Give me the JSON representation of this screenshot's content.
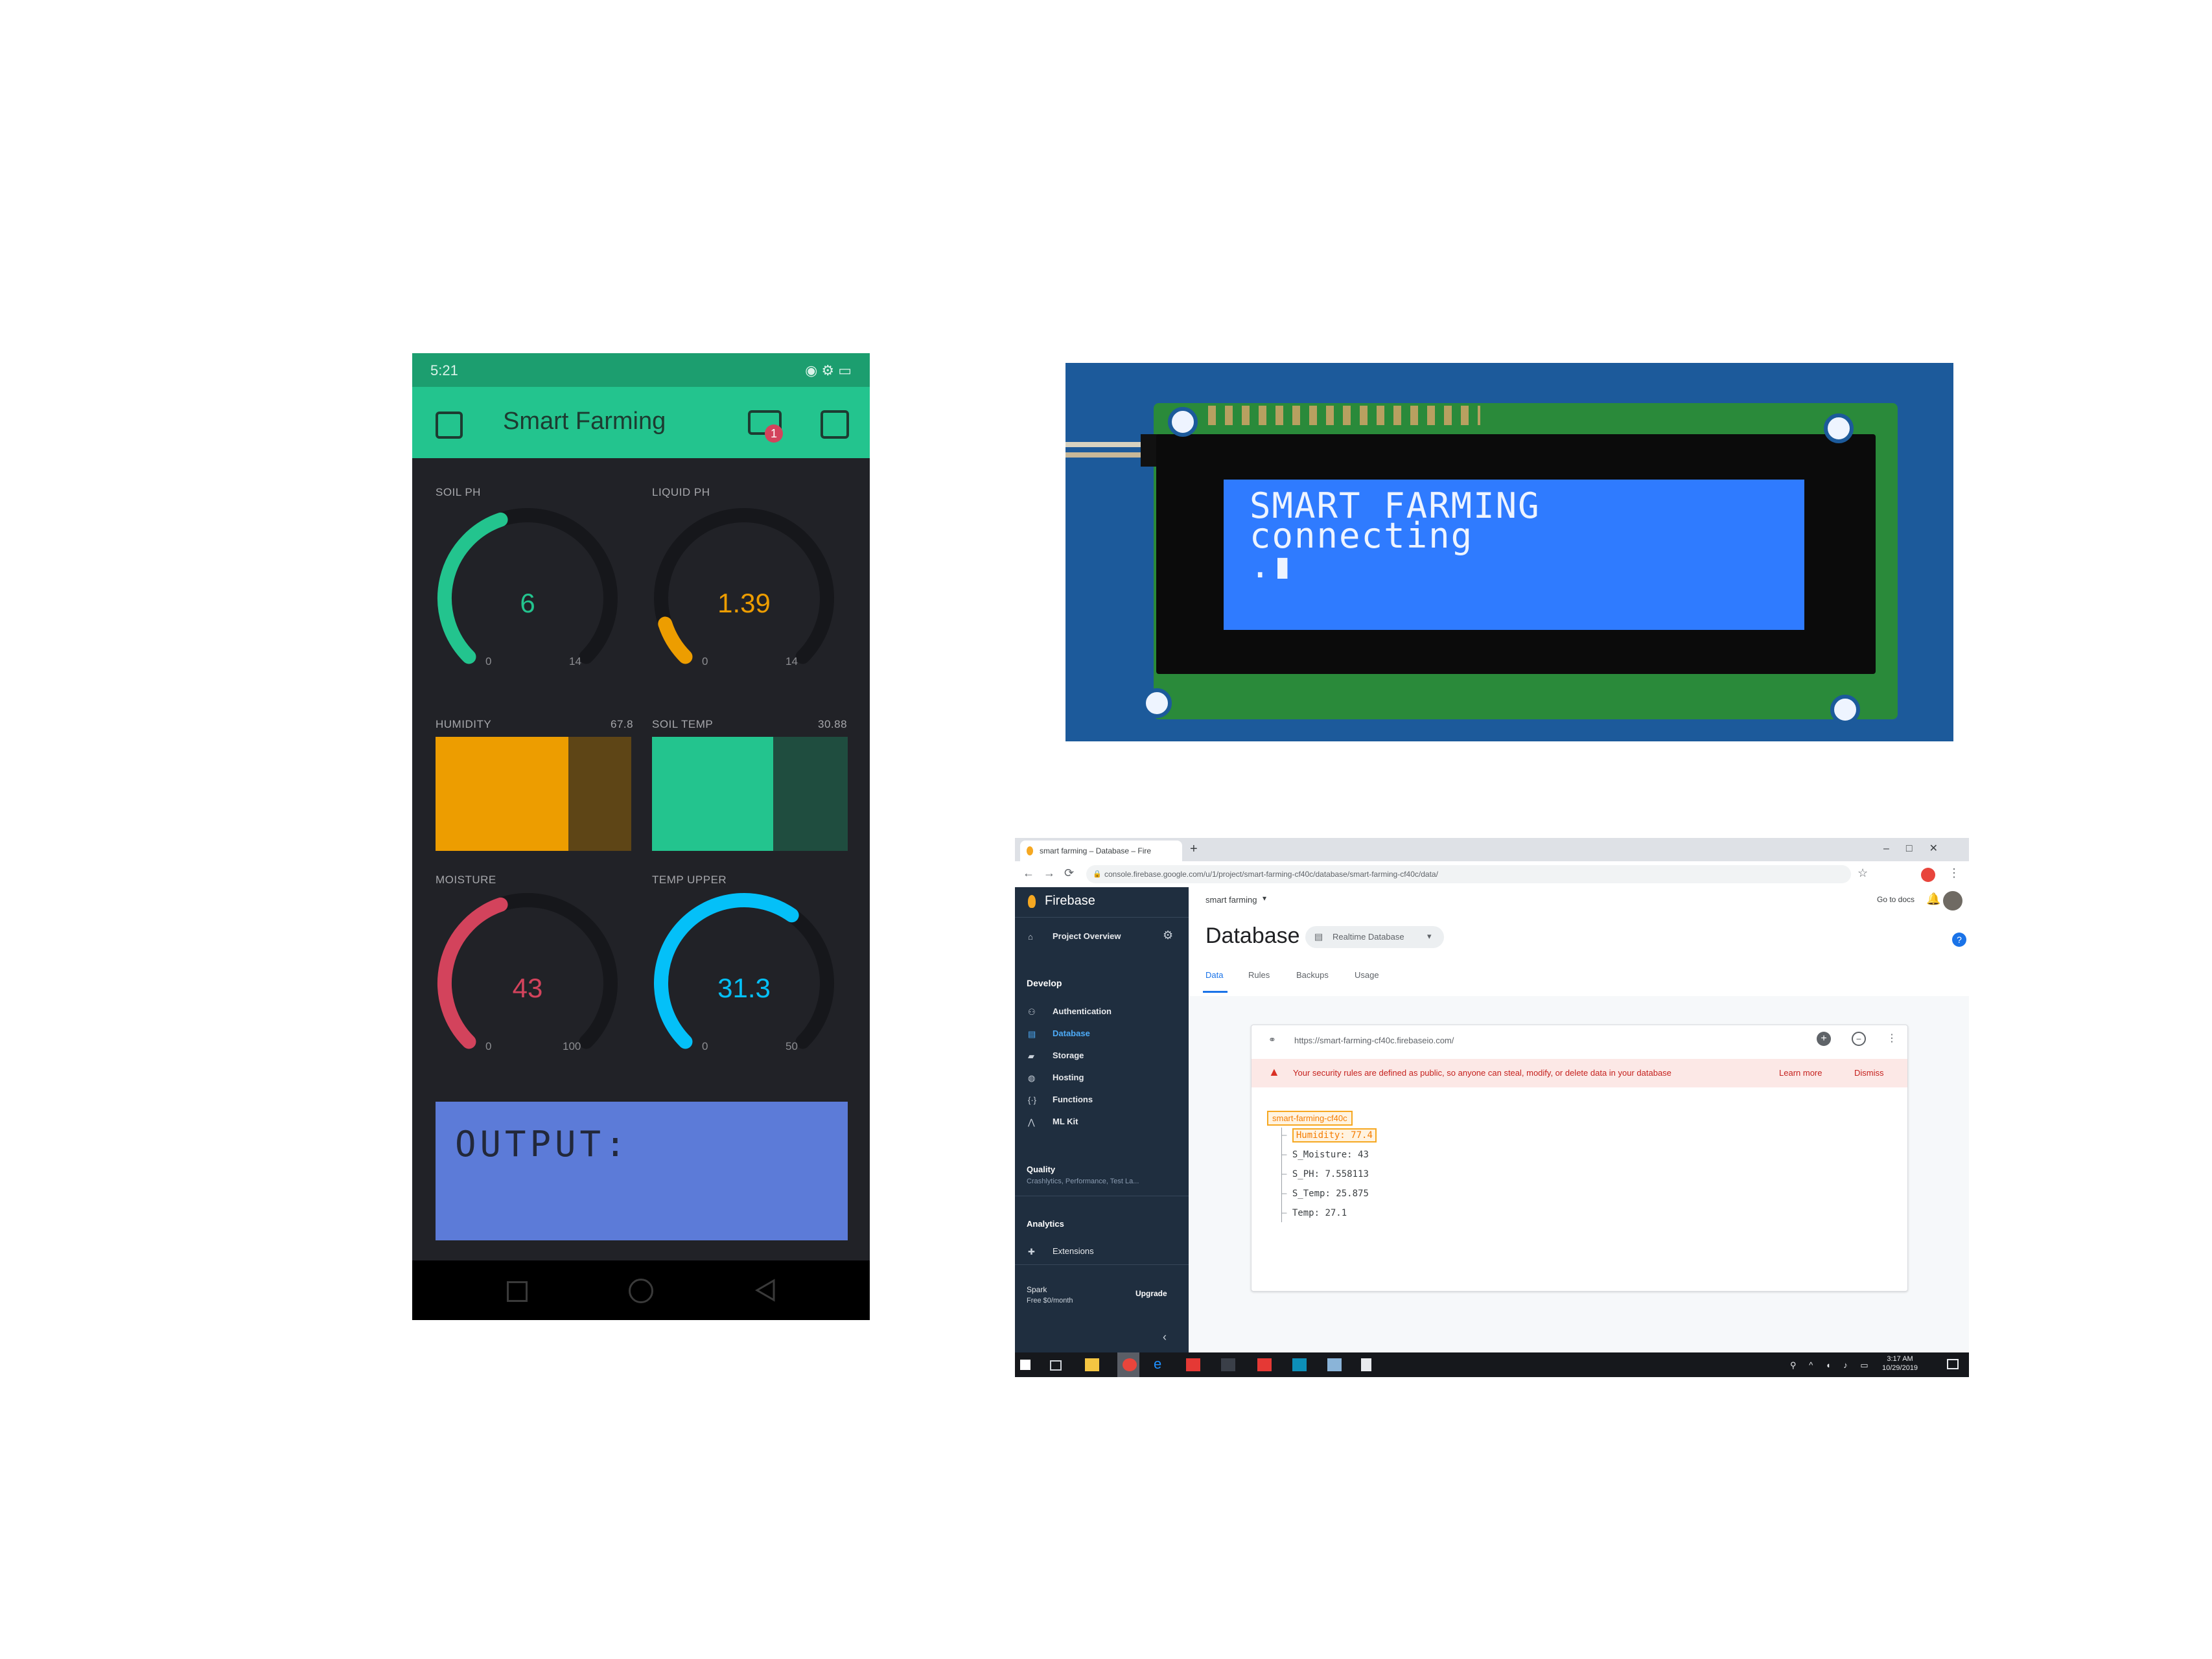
{
  "phone": {
    "status": {
      "time": "5:21",
      "icons": "◉ ⚙ ▭"
    },
    "app_title": "Smart Farming",
    "notification_count": "1",
    "gauges": [
      {
        "label": "SOIL PH",
        "value": "6",
        "min": "0",
        "max": "14",
        "color": "#23c48e",
        "fraction": 0.43
      },
      {
        "label": "LIQUID PH",
        "value": "1.39",
        "min": "0",
        "max": "14",
        "color": "#ed9d00",
        "fraction": 0.1
      },
      {
        "label": "MOISTURE",
        "value": "43",
        "min": "0",
        "max": "100",
        "color": "#d3435c",
        "fraction": 0.43
      },
      {
        "label": "TEMP UPPER",
        "value": "31.3",
        "min": "0",
        "max": "50",
        "color": "#04c0f8",
        "fraction": 0.63
      }
    ],
    "levels": [
      {
        "label": "HUMIDITY",
        "value": "67.8",
        "color": "#ed9d00",
        "dark": "#5e4516",
        "fraction": 0.678
      },
      {
        "label": "SOIL TEMP",
        "value": "30.88",
        "color": "#23c48e",
        "dark": "#1f4d3f",
        "fraction": 0.618
      }
    ],
    "lcd_text": "OUTPUT:"
  },
  "lcd_photo": {
    "line1": "SMART FARMING",
    "line2": "connecting",
    "line3": ".▮"
  },
  "browser": {
    "tab_title": "smart farming – Database – Fire",
    "url": "console.firebase.google.com/u/1/project/smart-farming-cf40c/database/smart-farming-cf40c/data/",
    "sidebar": {
      "brand": "Firebase",
      "project_overview": "Project Overview",
      "develop": "Develop",
      "items": [
        "Authentication",
        "Database",
        "Storage",
        "Hosting",
        "Functions",
        "ML Kit"
      ],
      "quality": "Quality",
      "quality_sub": "Crashlytics, Performance, Test La...",
      "analytics": "Analytics",
      "extensions": "Extensions",
      "plan": "Spark",
      "plan_sub": "Free $0/month",
      "upgrade": "Upgrade"
    },
    "project_selector": "smart farming",
    "go_to_docs": "Go to docs",
    "page_title": "Database",
    "db_selector": "Realtime Database",
    "tabs": [
      "Data",
      "Rules",
      "Backups",
      "Usage"
    ],
    "db_url": "https://smart-farming-cf40c.firebaseio.com/",
    "warning": "Your security rules are defined as public, so anyone can steal, modify, or delete data in your database",
    "learn_more": "Learn more",
    "dismiss": "Dismiss",
    "tree": {
      "root": "smart-farming-cf40c",
      "rows": [
        "Humidity: 77.4",
        "S_Moisture: 43",
        "S_PH: 7.558113",
        "S_Temp: 25.875",
        "Temp: 27.1"
      ]
    },
    "clock": {
      "time": "3:17 AM",
      "date": "10/29/2019"
    }
  }
}
